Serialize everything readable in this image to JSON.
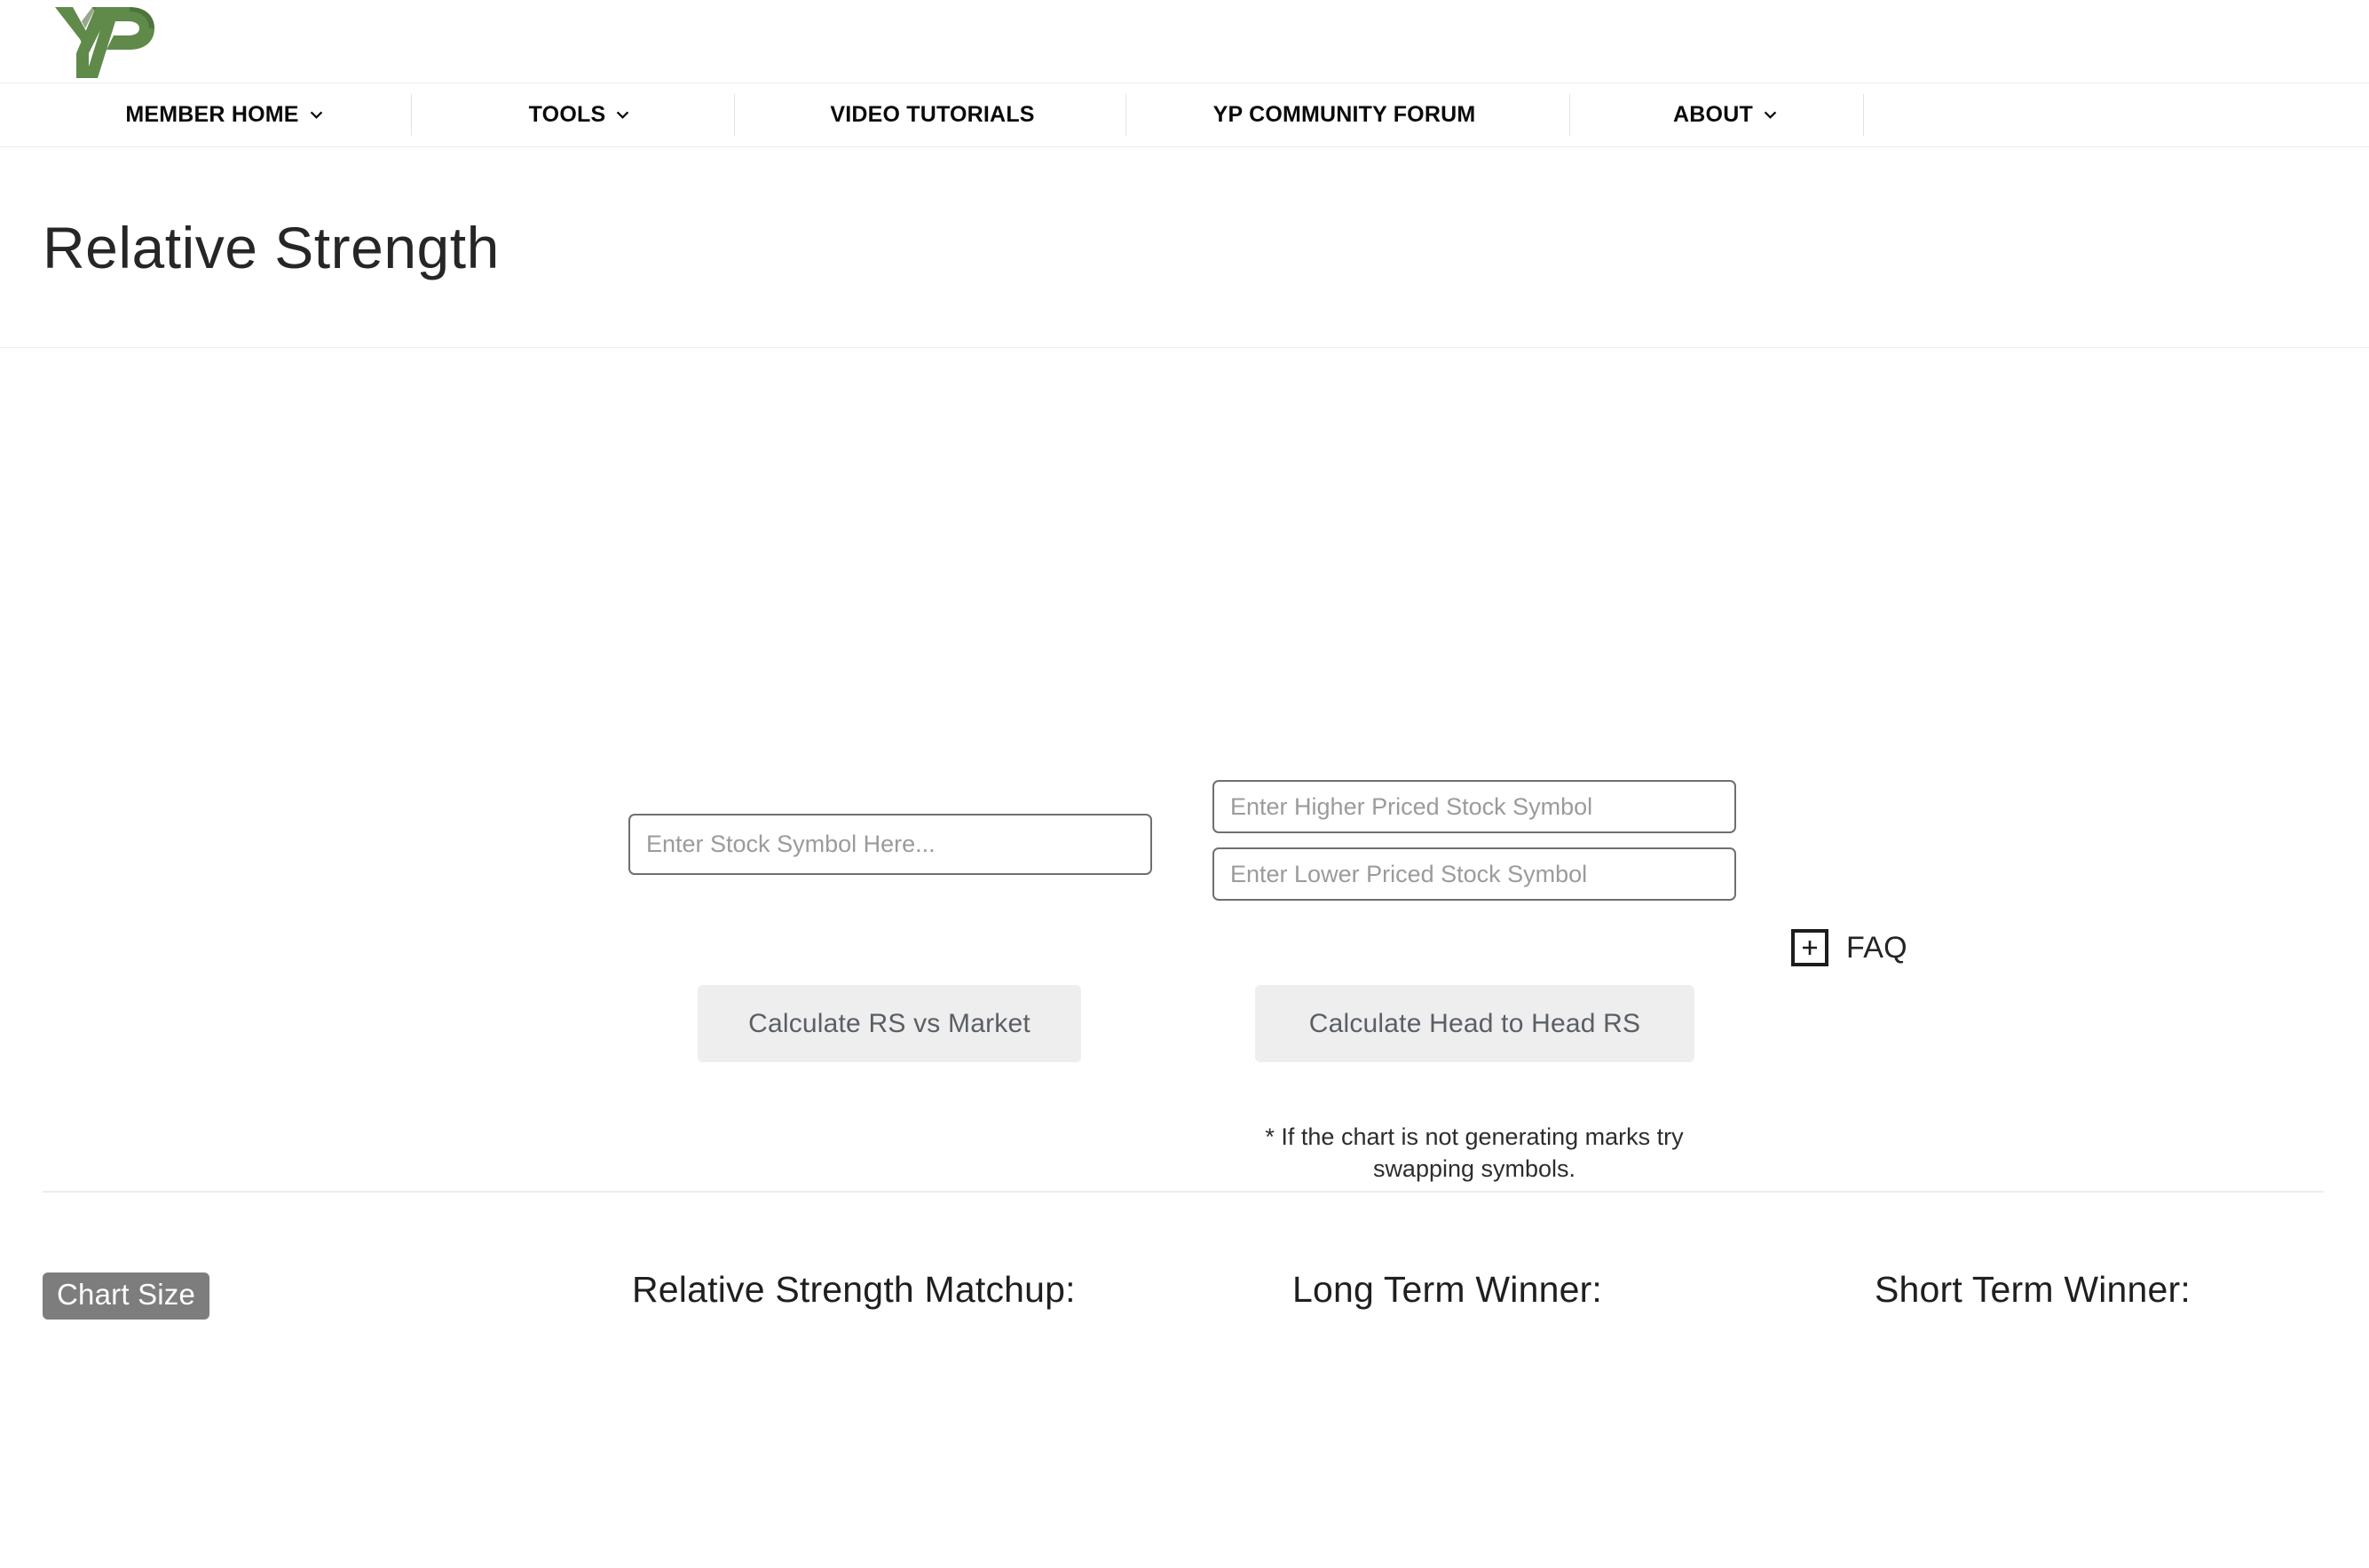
{
  "brand": {
    "logo_name": "YP",
    "logo_color": "#5f8a4a"
  },
  "nav": {
    "items": [
      {
        "label": "MEMBER HOME",
        "has_caret": true
      },
      {
        "label": "TOOLS",
        "has_caret": true
      },
      {
        "label": "VIDEO TUTORIALS",
        "has_caret": false
      },
      {
        "label": "YP COMMUNITY FORUM",
        "has_caret": false
      },
      {
        "label": "ABOUT",
        "has_caret": true
      }
    ]
  },
  "page": {
    "title": "Relative Strength"
  },
  "form": {
    "symbol_input": {
      "placeholder": "Enter Stock Symbol Here...",
      "value": ""
    },
    "higher_input": {
      "placeholder": "Enter Higher Priced Stock Symbol",
      "value": ""
    },
    "lower_input": {
      "placeholder": "Enter Lower Priced Stock Symbol",
      "value": ""
    },
    "calculate_market_label": "Calculate RS vs Market",
    "calculate_h2h_label": "Calculate Head to Head RS",
    "faq_label": "FAQ",
    "faq_icon": "plus-icon",
    "swap_note": "* If the chart is not generating marks try swapping symbols."
  },
  "results": {
    "chart_size_label": "Chart Size",
    "headings": [
      "Relative Strength Matchup:",
      "Long Term Winner:",
      "Short Term Winner:"
    ],
    "matchup_value": "",
    "long_term_winner_value": "",
    "short_term_winner_value": ""
  },
  "colors": {
    "brand_green": "#5f8a4a",
    "button_bg": "#eeeeee",
    "button_text": "#5a5f66",
    "chart_size_bg": "#7d7d7d",
    "input_border": "#6f6f6f",
    "placeholder": "#9b9b9b",
    "divider": "#ededed"
  }
}
